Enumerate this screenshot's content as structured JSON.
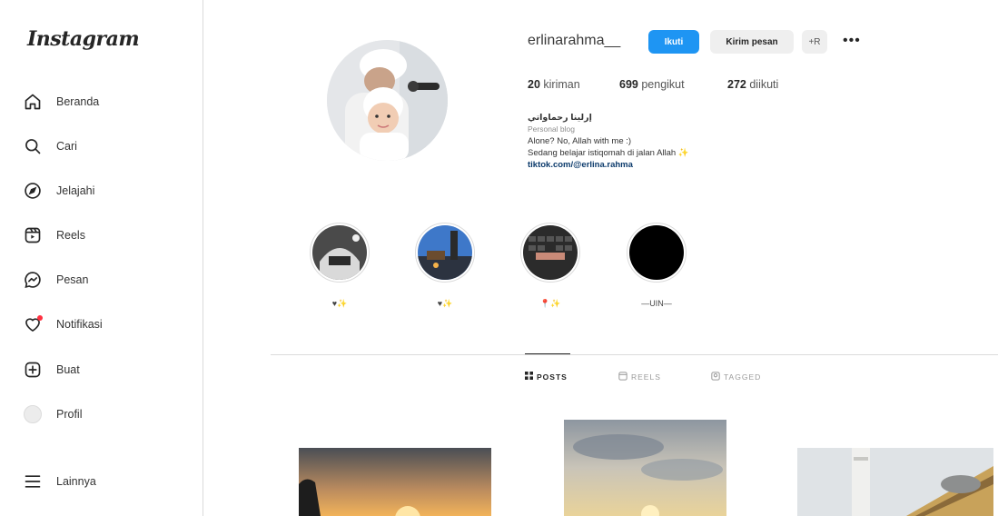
{
  "app": {
    "logo": "Instagram"
  },
  "sidebar": {
    "items": [
      {
        "label": "Beranda",
        "icon": "home-icon"
      },
      {
        "label": "Cari",
        "icon": "search-icon"
      },
      {
        "label": "Jelajahi",
        "icon": "explore-icon"
      },
      {
        "label": "Reels",
        "icon": "reels-icon"
      },
      {
        "label": "Pesan",
        "icon": "messenger-icon"
      },
      {
        "label": "Notifikasi",
        "icon": "heart-icon"
      },
      {
        "label": "Buat",
        "icon": "plus-square-icon"
      },
      {
        "label": "Profil",
        "icon": "avatar-icon"
      }
    ],
    "more": {
      "label": "Lainnya",
      "icon": "menu-icon"
    }
  },
  "profile": {
    "username": "erlinarahma__",
    "follow_label": "Ikuti",
    "message_label": "Kirim pesan",
    "suggest_label": "+R",
    "more_label": "•••",
    "stats": {
      "posts": {
        "count": "20",
        "label": "kiriman"
      },
      "followers": {
        "count": "699",
        "label": "pengikut"
      },
      "following": {
        "count": "272",
        "label": "diikuti"
      }
    },
    "bio": {
      "name": "إرلينا رحماواتي",
      "category": "Personal blog",
      "line1": "Alone? No, Allah with me :)",
      "line2": "Sedang belajar istiqomah di jalan Allah ✨",
      "link": "tiktok.com/@erlina.rahma"
    }
  },
  "highlights": [
    {
      "label": "♥✨"
    },
    {
      "label": "♥✨"
    },
    {
      "label": "📍✨"
    },
    {
      "label": "—UIN—"
    }
  ],
  "tabs": [
    {
      "label": "POSTS",
      "icon": "grid-icon"
    },
    {
      "label": "REELS",
      "icon": "reels-icon"
    },
    {
      "label": "TAGGED",
      "icon": "tagged-icon"
    }
  ],
  "colors": {
    "accent": "#1e95f3",
    "notif": "#ff3040",
    "border": "#dbdbdb"
  }
}
